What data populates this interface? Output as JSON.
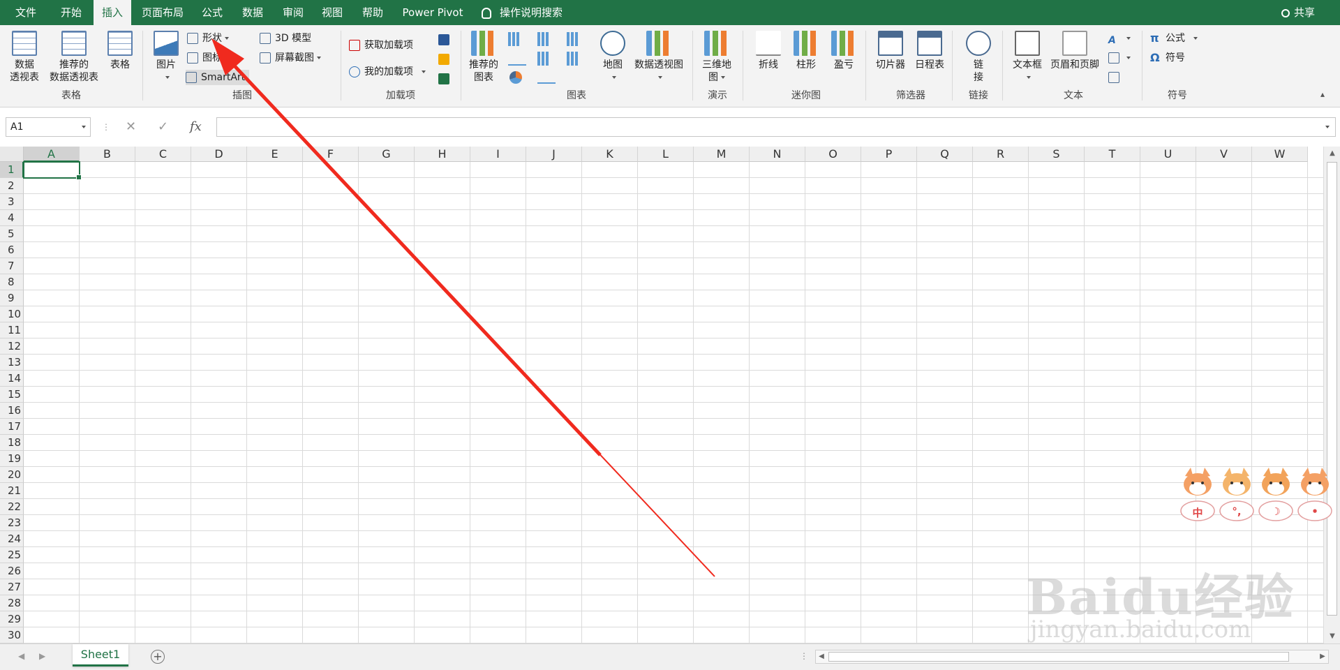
{
  "tabs": [
    {
      "label": "文件",
      "active": false
    },
    {
      "label": "开始",
      "active": false
    },
    {
      "label": "插入",
      "active": true
    },
    {
      "label": "页面布局",
      "active": false
    },
    {
      "label": "公式",
      "active": false
    },
    {
      "label": "数据",
      "active": false
    },
    {
      "label": "审阅",
      "active": false
    },
    {
      "label": "视图",
      "active": false
    },
    {
      "label": "帮助",
      "active": false
    },
    {
      "label": "Power Pivot",
      "active": false
    }
  ],
  "tell_me": "操作说明搜索",
  "share": "共享",
  "ribbon": {
    "tables": {
      "pivot": [
        "数据",
        "透视表"
      ],
      "recommended_pivot": [
        "推荐的",
        "数据透视表"
      ],
      "table": "表格",
      "group": "表格"
    },
    "illustrations": {
      "picture": "图片",
      "shapes": "形状",
      "icons": "图标",
      "smartart": "SmartArt",
      "model3d": "3D 模型",
      "screenshot": "屏幕截图",
      "group": "插图"
    },
    "addins": {
      "get": "获取加载项",
      "mine": "我的加载项",
      "group": "加载项"
    },
    "charts": {
      "recommended": [
        "推荐的",
        "图表"
      ],
      "map": "地图",
      "pivotchart": "数据透视图",
      "group": "图表"
    },
    "tours": {
      "map3d": [
        "三维地",
        "图"
      ],
      "group": "演示"
    },
    "sparklines": {
      "line": "折线",
      "column": "柱形",
      "winloss": "盈亏",
      "group": "迷你图"
    },
    "filters": {
      "slicer": "切片器",
      "timeline": "日程表",
      "group": "筛选器"
    },
    "links": {
      "link": [
        "链",
        "接"
      ],
      "group": "链接"
    },
    "text": {
      "textbox": "文本框",
      "headerfooter": "页眉和页脚",
      "group": "文本"
    },
    "symbols": {
      "equation": "公式",
      "symbol": "符号",
      "group": "符号"
    }
  },
  "namebox": "A1",
  "formula_value": "",
  "columns": [
    "A",
    "B",
    "C",
    "D",
    "E",
    "F",
    "G",
    "H",
    "I",
    "J",
    "K",
    "L",
    "M",
    "N",
    "O",
    "P",
    "Q",
    "R",
    "S",
    "T",
    "U",
    "V",
    "W"
  ],
  "rows": [
    "1",
    "2",
    "3",
    "4",
    "5",
    "6",
    "7",
    "8",
    "9",
    "10",
    "11",
    "12",
    "13",
    "14",
    "15",
    "16",
    "17",
    "18",
    "19",
    "20",
    "21",
    "22",
    "23",
    "24",
    "25",
    "26",
    "27",
    "28",
    "29",
    "30"
  ],
  "active_cell": "A1",
  "sheet_tab": "Sheet1",
  "watermark": {
    "brand": "Baidu经验",
    "url": "jingyan.baidu.com"
  },
  "sticker_chars": [
    "中",
    "°,",
    "☽",
    "•"
  ],
  "colors": {
    "excel_green": "#217346",
    "arrow_red": "#f02a1e"
  }
}
